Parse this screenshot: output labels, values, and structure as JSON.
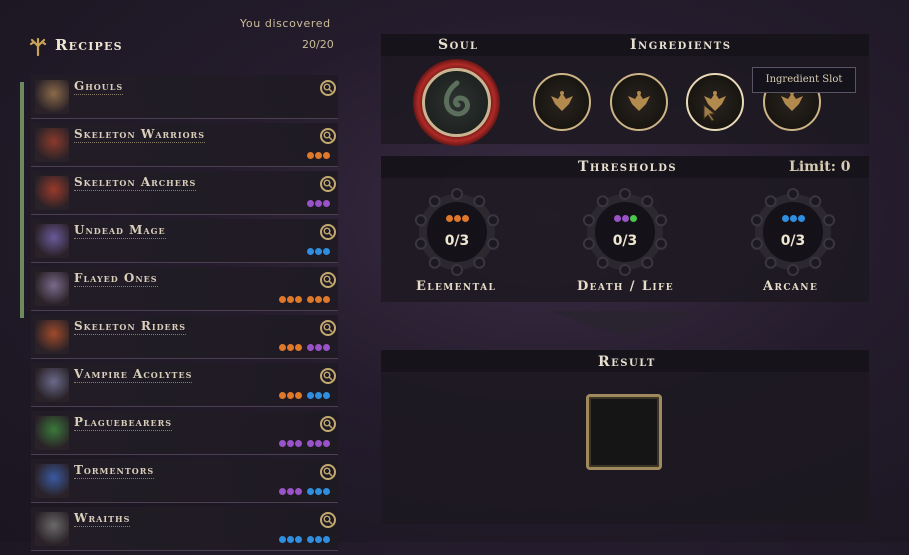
{
  "recipes": {
    "title": "Recipes",
    "discovered_label": "You discovered",
    "discovered_count": "20/20",
    "items": [
      {
        "name": "Ghouls",
        "portrait_color": "#8a6a4a",
        "groups": []
      },
      {
        "name": "Skeleton Warriors",
        "portrait_color": "#8a3a2a",
        "groups": [
          [
            "#e0782a",
            "#e0782a",
            "#e0782a"
          ]
        ]
      },
      {
        "name": "Skeleton Archers",
        "portrait_color": "#9a3a2a",
        "groups": [
          [
            "#9a52c8",
            "#9a52c8",
            "#9a52c8"
          ]
        ]
      },
      {
        "name": "Undead Mage",
        "portrait_color": "#6a5a9a",
        "groups": [
          [
            "#2e8fe0",
            "#2e8fe0",
            "#2e8fe0"
          ]
        ]
      },
      {
        "name": "Flayed Ones",
        "portrait_color": "#7a6a8a",
        "groups": [
          [
            "#e0782a",
            "#e0782a",
            "#e0782a"
          ],
          [
            "#e0782a",
            "#e0782a",
            "#e0782a"
          ]
        ]
      },
      {
        "name": "Skeleton Riders",
        "portrait_color": "#a04a2a",
        "groups": [
          [
            "#e0782a",
            "#e0782a",
            "#e0782a"
          ],
          [
            "#9a52c8",
            "#9a52c8",
            "#9a52c8"
          ]
        ]
      },
      {
        "name": "Vampire Acolytes",
        "portrait_color": "#6a6a8a",
        "groups": [
          [
            "#e0782a",
            "#e0782a",
            "#e0782a"
          ],
          [
            "#2e8fe0",
            "#2e8fe0",
            "#2e8fe0"
          ]
        ]
      },
      {
        "name": "Plaguebearers",
        "portrait_color": "#3a7a3a",
        "groups": [
          [
            "#9a52c8",
            "#9a52c8",
            "#9a52c8"
          ],
          [
            "#9a52c8",
            "#9a52c8",
            "#9a52c8"
          ]
        ]
      },
      {
        "name": "Tormentors",
        "portrait_color": "#3a5aa0",
        "groups": [
          [
            "#9a52c8",
            "#9a52c8",
            "#9a52c8"
          ],
          [
            "#2e8fe0",
            "#2e8fe0",
            "#2e8fe0"
          ]
        ]
      },
      {
        "name": "Wraiths",
        "portrait_color": "#6a6a6a",
        "groups": [
          [
            "#2e8fe0",
            "#2e8fe0",
            "#2e8fe0"
          ],
          [
            "#2e8fe0",
            "#2e8fe0",
            "#2e8fe0"
          ]
        ]
      }
    ]
  },
  "soul": {
    "title": "Soul",
    "icon": "swirl-soul-icon"
  },
  "ingredients": {
    "title": "Ingredients",
    "slot_icon": "bee-emblem-icon",
    "tooltip": "Ingredient Slot"
  },
  "thresholds": {
    "title": "Thresholds",
    "limit": "Limit: 0",
    "items": [
      {
        "label": "Elemental",
        "value": "0/3",
        "dots": [
          "#e0782a",
          "#e0782a",
          "#e0782a"
        ]
      },
      {
        "label": "Death / Life",
        "value": "0/3",
        "dots": [
          "#9a52c8",
          "#9a52c8",
          "#4ac84a"
        ]
      },
      {
        "label": "Arcane",
        "value": "0/3",
        "dots": [
          "#2e8fe0",
          "#2e8fe0",
          "#2e8fe0"
        ]
      }
    ]
  },
  "result": {
    "title": "Result"
  },
  "colors": {
    "accent_gold": "#c4a970",
    "soul_red": "#b02a26"
  }
}
